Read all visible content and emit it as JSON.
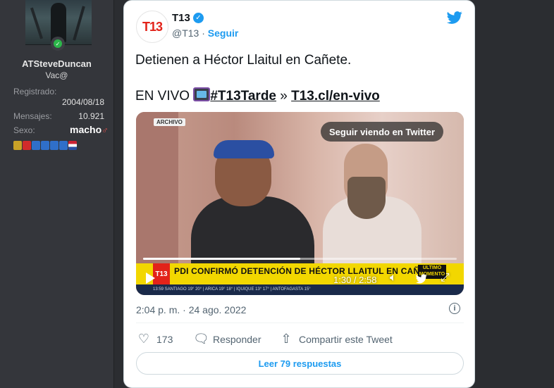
{
  "user": {
    "name": "ATSteveDuncan",
    "title": "Vac@",
    "registered_label": "Registrado:",
    "registered_value": "2004/08/18",
    "posts_label": "Mensajes:",
    "posts_value": "10.921",
    "sex_label": "Sexo:",
    "sex_value": "macho",
    "sex_symbol": "♂"
  },
  "tweet": {
    "account_name": "T13",
    "logo_text": "T13",
    "handle": "@T13",
    "separator": " · ",
    "follow": "Seguir",
    "text_line1": "Detienen a Héctor Llaitul en Cañete.",
    "text_line2_prefix": "EN VIVO ",
    "hashtag": "#T13Tarde",
    "arrow": " » ",
    "link": "T13.cl/en-vivo",
    "timestamp": "2:04 p. m. · 24 ago. 2022",
    "likes_count": "173",
    "reply_label": "Responder",
    "share_label": "Compartir este Tweet",
    "read_replies": "Leer 79 respuestas"
  },
  "video": {
    "archivo": "ARCHIVO",
    "continue_label": "Seguir viendo en Twitter",
    "ticker_logo": "T13",
    "ticker_text": "PDI CONFIRMÓ DETENCIÓN DE HÉCTOR LLAITUL EN CAÑETE",
    "ticker_ultimo": "ÚLTIMO MOMENTO",
    "crawl_text": "13:59   SANTIAGO  19°  20°  | ARICA  19°  18°  | IQUIQUE  13°  17°  | ANTOFAGASTA  15°",
    "time": "1:30 / 2:58",
    "progress": 0.5
  },
  "colors": {
    "twitter_blue": "#1d9bf0",
    "t13_red": "#e2231a",
    "ticker_yellow": "#f2d700",
    "online_green": "#2cb74a"
  },
  "icons": {
    "bird": "twitter-bird-icon",
    "verified": "verified-badge-icon",
    "heart": "heart-icon",
    "reply": "reply-icon",
    "share": "share-icon",
    "info": "info-icon",
    "volume": "volume-icon",
    "fullscreen": "fullscreen-icon"
  }
}
